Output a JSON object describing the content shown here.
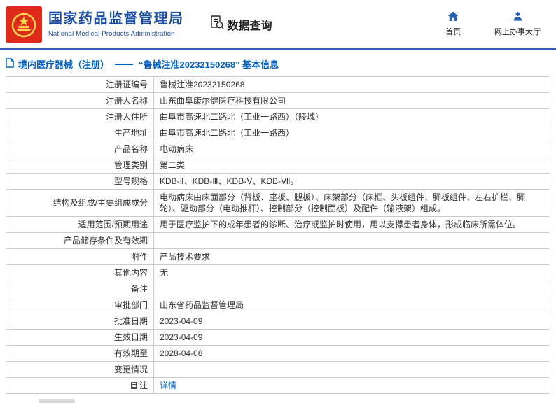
{
  "colors": {
    "brand_blue": "#1c4ea2",
    "link_blue": "#0066cc",
    "divider_blue": "#2e62ae",
    "emblem_red": "#dd2a1b",
    "emblem_gold": "#f8d64e",
    "border_gray": "#cccccc",
    "text_dark": "#333333"
  },
  "header": {
    "org_name_cn": "国家药品监督管理局",
    "org_name_en": "National Medical Products Administration",
    "section_title": "数据查询",
    "nav": [
      {
        "label": "首页",
        "icon": "home-icon"
      },
      {
        "label": "网上办事大厅",
        "icon": "person-icon"
      }
    ]
  },
  "breadcrumb": {
    "icon": "document-icon",
    "category": "境内医疗器械（注册）",
    "separator": "——",
    "title": "“鲁械注准20232150268” 基本信息"
  },
  "table": {
    "rows": [
      {
        "label": "注册证编号",
        "value": "鲁械注准20232150268"
      },
      {
        "label": "注册人名称",
        "value": "山东曲阜康尔健医疗科技有限公司"
      },
      {
        "label": "注册人住所",
        "value": "曲阜市高速北二路北（工业一路西）（陵城）"
      },
      {
        "label": "生产地址",
        "value": "曲阜市高速北二路北（工业一路西）"
      },
      {
        "label": "产品名称",
        "value": "电动病床"
      },
      {
        "label": "管理类别",
        "value": "第二类"
      },
      {
        "label": "型号规格",
        "value": "KDB-Ⅱ、KDB-Ⅲ、KDB-Ⅴ、KDB-Ⅶ。"
      },
      {
        "label": "结构及组成/主要组成成分",
        "value": "电动病床由床面部分（背板、座板、腿板）、床架部分（床框、头板组件、脚板组件、左右护栏、脚轮）、驱动部分（电动推杆）、控制部分（控制面板）及配件（输液架）组成。"
      },
      {
        "label": "适用范围/预期用途",
        "value": "用于医疗监护下的成年患者的诊断、治疗或监护时使用，用以支撑患者身体，形成临床所需体位。"
      },
      {
        "label": "产品储存条件及有效期",
        "value": ""
      },
      {
        "label": "附件",
        "value": "产品技术要求"
      },
      {
        "label": "其他内容",
        "value": "无"
      },
      {
        "label": "备注",
        "value": ""
      },
      {
        "label": "审批部门",
        "value": "山东省药品监督管理局"
      },
      {
        "label": "批准日期",
        "value": "2023-04-09"
      },
      {
        "label": "生效日期",
        "value": "2023-04-09"
      },
      {
        "label": "有效期至",
        "value": "2028-04-08"
      },
      {
        "label": "变更情况",
        "value": ""
      },
      {
        "label": "注",
        "label_icon": "note-icon",
        "value": "详情",
        "link": true
      }
    ]
  }
}
